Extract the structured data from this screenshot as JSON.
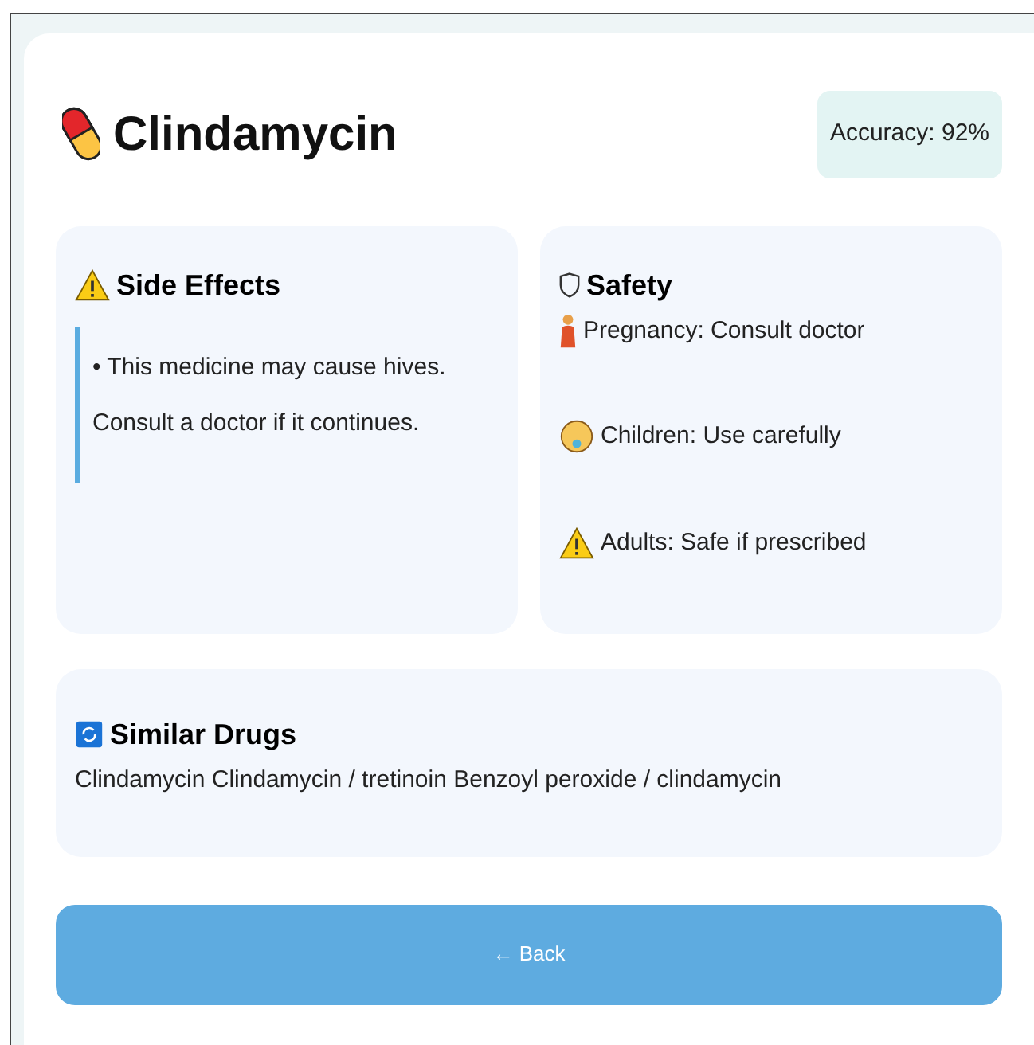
{
  "drug": {
    "name": "Clindamycin",
    "accuracy": "Accuracy: 92%"
  },
  "side_effects": {
    "title": "Side Effects",
    "items": [
      "• This medicine may cause hives. Consult a doctor if it continues."
    ]
  },
  "safety": {
    "title": "Safety",
    "items": [
      {
        "kind": "pregnancy",
        "text": "Pregnancy: Consult doctor"
      },
      {
        "kind": "child",
        "text": "Children: Use carefully"
      },
      {
        "kind": "caution",
        "text": "Adults: Safe if prescribed"
      }
    ]
  },
  "similar_drugs": {
    "title": "Similar Drugs",
    "text": "Clindamycin Clindamycin / tretinoin Benzoyl peroxide / clindamycin"
  },
  "back_button": "← Back"
}
